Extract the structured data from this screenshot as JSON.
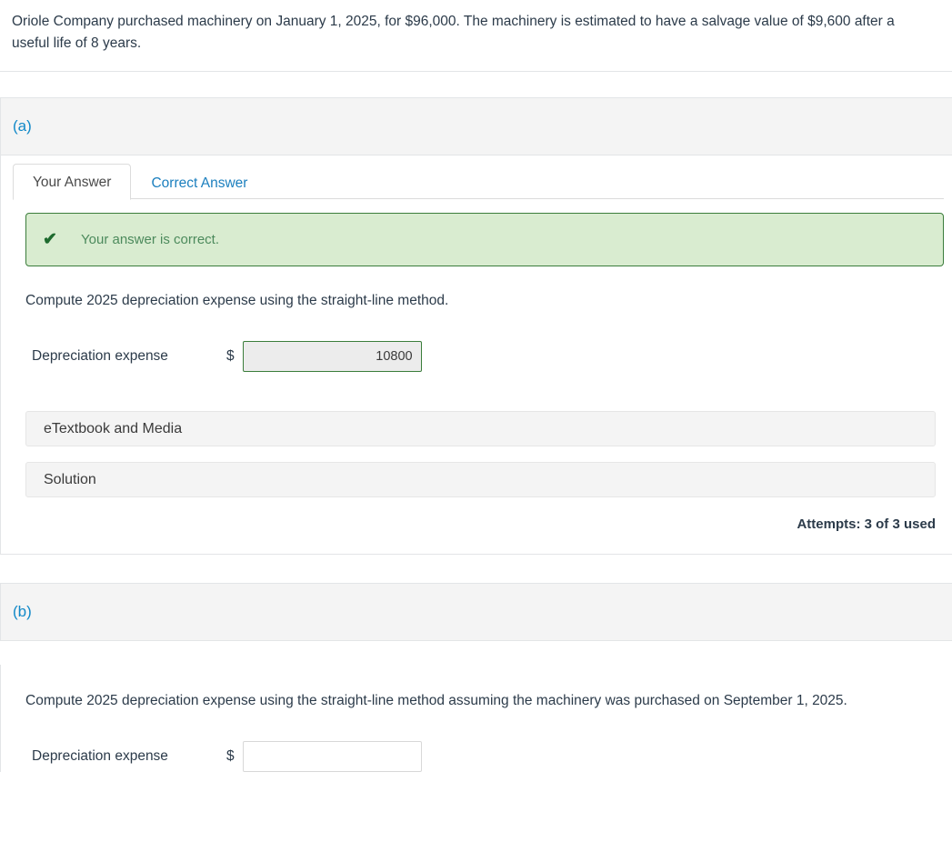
{
  "problem": {
    "statement": "Oriole Company purchased machinery on January 1, 2025, for $96,000. The machinery is estimated to have a salvage value of $9,600 after a useful life of 8 years."
  },
  "parts": [
    {
      "label": "(a)",
      "tabs": [
        {
          "label": "Your Answer",
          "active": true
        },
        {
          "label": "Correct Answer",
          "active": false
        }
      ],
      "alert": {
        "icon": "check-icon",
        "text": "Your answer is correct.",
        "color": "#d9ecd0",
        "border_color": "#3b7d3b",
        "text_color": "#4c8a5c"
      },
      "prompt": "Compute 2025 depreciation expense using the straight-line method.",
      "answer": {
        "label": "Depreciation expense",
        "currency": "$",
        "value": "10800",
        "placeholder": ""
      },
      "panels": [
        {
          "label": "eTextbook and Media"
        },
        {
          "label": "Solution"
        }
      ],
      "attempts": "Attempts: 3 of 3 used"
    },
    {
      "label": "(b)",
      "prompt": "Compute 2025 depreciation expense using the straight-line method assuming the machinery was purchased on September 1, 2025.",
      "answer": {
        "label": "Depreciation expense",
        "currency": "$",
        "value": "",
        "placeholder": ""
      }
    }
  ],
  "colors": {
    "part_label": "#1189c8",
    "link": "#1b7fbe",
    "text": "#2c3b4a",
    "band_bg": "#f4f4f4",
    "divider": "#e3e5e7",
    "success_bg": "#d9ecd0",
    "success_border": "#3b7d3b"
  }
}
